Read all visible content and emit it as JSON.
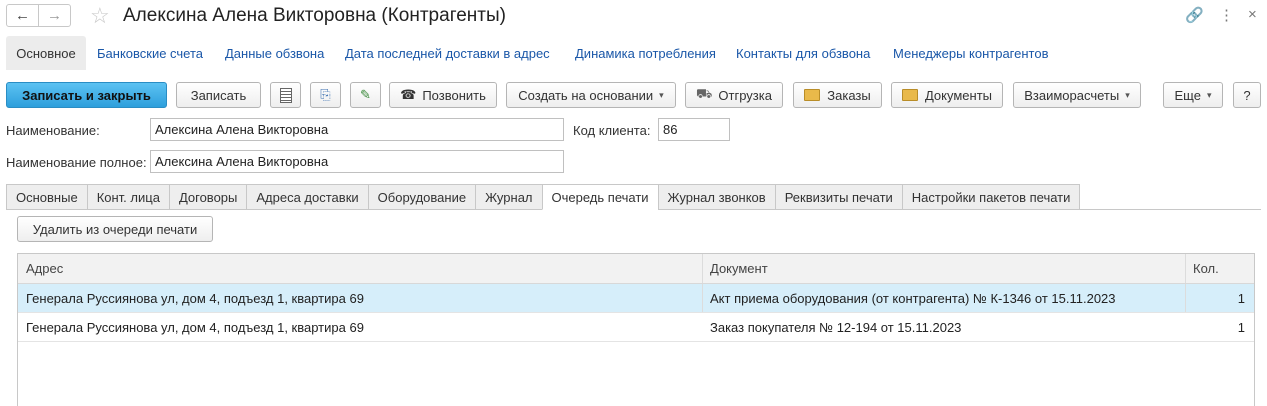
{
  "window": {
    "title": "Алексина Алена Викторовна (Контрагенты)",
    "nav_back": "←",
    "nav_forward": "→",
    "favorite_icon": "star-icon",
    "link_icon": "🔗",
    "more_icon": "⋮",
    "close_icon": "×"
  },
  "sections": {
    "active": "Основное",
    "links": [
      "Банковские счета",
      "Данные обзвона",
      "Дата последней доставки в адрес",
      "Динамика потребления",
      "Контакты для обзвона",
      "Менеджеры контрагентов"
    ]
  },
  "toolbar": {
    "save_close": "Записать и закрыть",
    "save": "Записать",
    "call": "Позвонить",
    "create_based": "Создать на основании",
    "shipment": "Отгрузка",
    "orders": "Заказы",
    "documents": "Документы",
    "settlements": "Взаиморасчеты",
    "more": "Еще",
    "help": "?"
  },
  "form": {
    "name_label": "Наименование:",
    "name_value": "Алексина Алена Викторовна",
    "client_code_label": "Код клиента:",
    "client_code_value": "86",
    "full_name_label": "Наименование полное:",
    "full_name_value": "Алексина Алена Викторовна"
  },
  "tabs": [
    "Основные",
    "Конт. лица",
    "Договоры",
    "Адреса доставки",
    "Оборудование",
    "Журнал",
    "Очередь печати",
    "Журнал звонков",
    "Реквизиты печати",
    "Настройки пакетов печати"
  ],
  "active_tab": "Очередь печати",
  "queue": {
    "remove_button": "Удалить из очереди печати",
    "columns": [
      "Адрес",
      "Документ",
      "Кол."
    ],
    "rows": [
      {
        "address": "Генерала Руссиянова ул,  дом 4,  подъезд 1,  квартира 69",
        "document": "Акт приема оборудования (от контрагента) № К-1346 от 15.11.2023",
        "qty": "1"
      },
      {
        "address": "Генерала Руссиянова ул,  дом 4,  подъезд 1,  квартира 69",
        "document": "Заказ покупателя № 12-194 от 15.11.2023",
        "qty": "1"
      }
    ]
  },
  "colors": {
    "primary_button": "#2d9fdc",
    "link": "#1a57a8",
    "selected_row": "#d6eefa"
  }
}
